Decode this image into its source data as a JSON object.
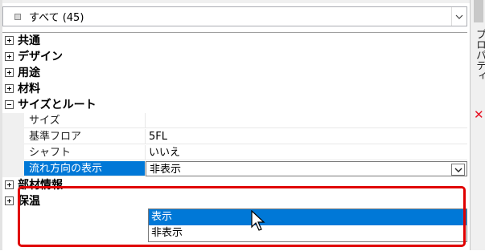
{
  "filter": {
    "text": "すべて (45)"
  },
  "categories": [
    {
      "label": "共通",
      "expanded": false
    },
    {
      "label": "デザイン",
      "expanded": false
    },
    {
      "label": "用途",
      "expanded": false
    },
    {
      "label": "材料",
      "expanded": false
    },
    {
      "label": "サイズとルート",
      "expanded": true
    },
    {
      "label": "部材情報",
      "expanded": false
    },
    {
      "label": "保温",
      "expanded": false
    }
  ],
  "properties": [
    {
      "name": "サイズ",
      "value": ""
    },
    {
      "name": "基準フロア",
      "value": "5FL"
    },
    {
      "name": "シャフト",
      "value": "いいえ"
    },
    {
      "name": "流れ方向の表示",
      "value": "非表示"
    }
  ],
  "dropdown": {
    "options": [
      "表示",
      "非表示"
    ],
    "highlighted": "表示"
  },
  "side_panel": {
    "title": "プロパティ"
  },
  "colors": {
    "selection": "#0078d7",
    "highlight_box": "#e00000",
    "close": "#e81123"
  }
}
